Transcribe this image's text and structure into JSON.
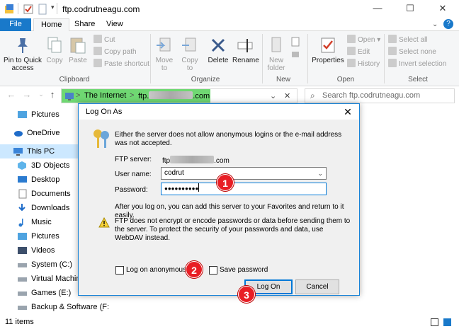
{
  "window": {
    "title": "ftp.codrutneagu.com",
    "minimize": "—",
    "maximize": "☐",
    "close": "✕",
    "help": "?"
  },
  "ribbon_tabs": [
    "File",
    "Home",
    "Share",
    "View"
  ],
  "ribbon": {
    "clipboard": {
      "pin": "Pin to Quick access",
      "copy": "Copy",
      "paste": "Paste",
      "cut": "Cut",
      "copy_path": "Copy path",
      "paste_shortcut": "Paste shortcut",
      "group": "Clipboard"
    },
    "organize": {
      "move_to": "Move to",
      "copy_to": "Copy to",
      "delete": "Delete",
      "rename": "Rename",
      "group": "Organize"
    },
    "new": {
      "new_folder": "New folder",
      "group": "New"
    },
    "open": {
      "properties": "Properties",
      "open": "Open",
      "edit": "Edit",
      "history": "History",
      "group": "Open"
    },
    "select": {
      "select_all": "Select all",
      "select_none": "Select none",
      "invert": "Invert selection",
      "group": "Select"
    }
  },
  "address": {
    "seg1": "The Internet",
    "seg2_prefix": "ftp.",
    "seg2_suffix": ".com",
    "sep": ">"
  },
  "search": {
    "placeholder": "Search ftp.codrutneagu.com"
  },
  "sidebar": {
    "items": [
      "Pictures",
      "OneDrive",
      "This PC",
      "3D Objects",
      "Desktop",
      "Documents",
      "Downloads",
      "Music",
      "Pictures",
      "Videos",
      "System (C:)",
      "Virtual Machines",
      "Games (E:)",
      "Backup & Software (F:"
    ]
  },
  "status": {
    "count": "11 items"
  },
  "dialog": {
    "title": "Log On As",
    "intro": "Either the server does not allow anonymous logins or the e-mail address was not accepted.",
    "ftp_server_label": "FTP server:",
    "ftp_server_prefix": "ftp",
    "ftp_server_suffix": ".com",
    "username_label": "User name:",
    "username_value": "codrut",
    "password_label": "Password:",
    "password_value": "●●●●●●●●●●",
    "after_logon": "After you log on, you can add this server to your Favorites and return to it easily.",
    "warning": "FTP does not encrypt or encode passwords or data before sending them to the server.  To protect the security of your passwords and data, use WebDAV instead.",
    "anon_label": "Log on anonymously",
    "save_pw_label": "Save password",
    "logon_btn": "Log On",
    "cancel_btn": "Cancel"
  },
  "badges": [
    "1",
    "2",
    "3"
  ],
  "colors": {
    "accent": "#1979ca",
    "badge": "#e81e25",
    "address_highlight": "#6fd872"
  }
}
